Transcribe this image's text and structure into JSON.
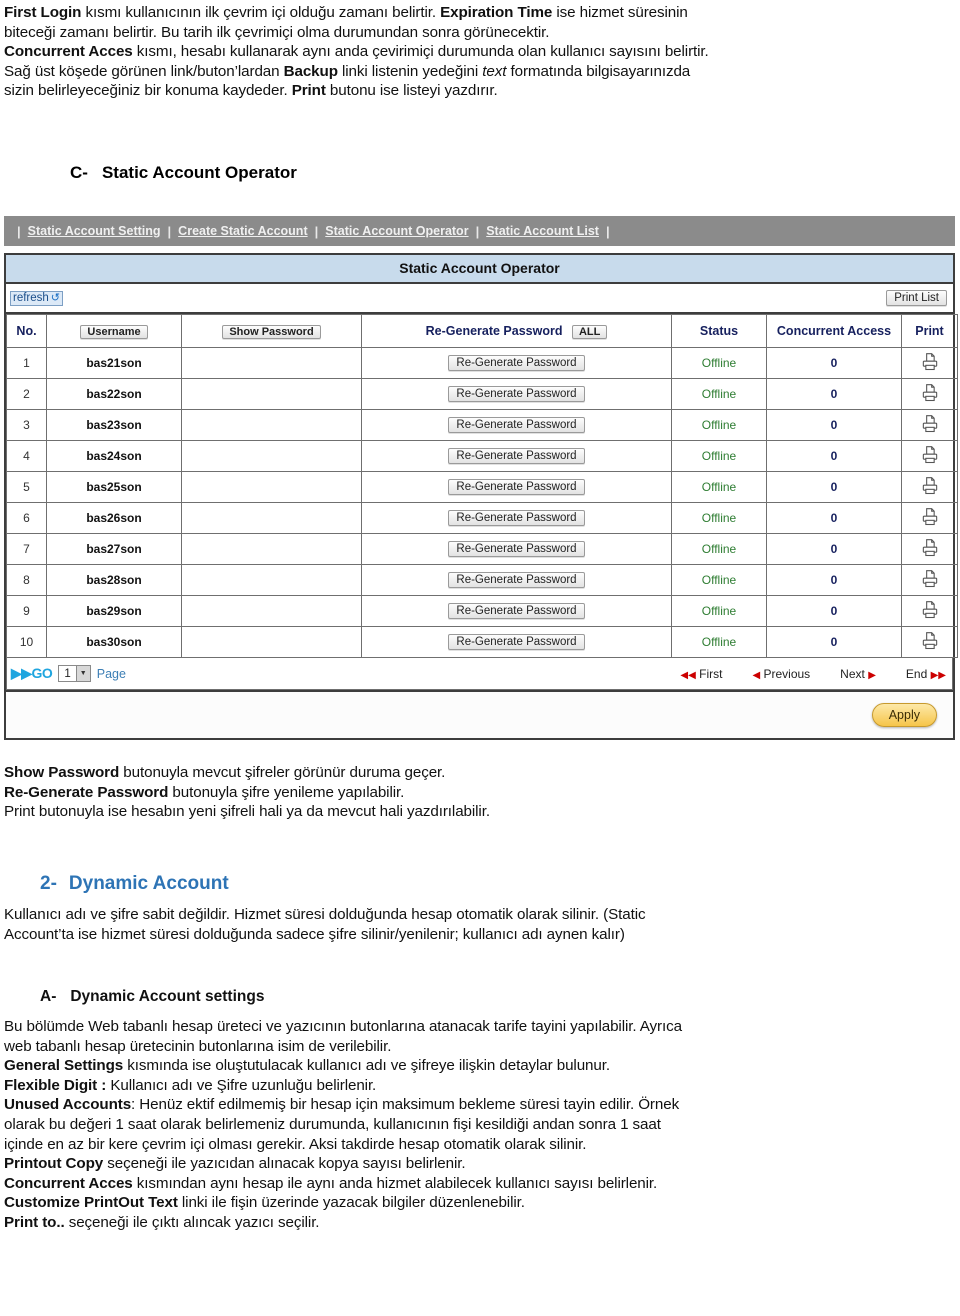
{
  "doc": {
    "intro": [
      {
        "id": "p1",
        "runs": [
          {
            "t": "First Login",
            "s": "b"
          },
          {
            "t": " kısmı kullanıcının ilk çevrim içi olduğu zamanı belirtir. ",
            "s": ""
          },
          {
            "t": "Expiration Time",
            "s": "b"
          },
          {
            "t": " ise hizmet süresinin",
            "s": ""
          }
        ]
      },
      {
        "id": "p2",
        "runs": [
          {
            "t": "biteceği zamanı belirtir. Bu tarih ilk çevrimiçi olma durumundan sonra görünecektir.",
            "s": ""
          }
        ]
      },
      {
        "id": "p3",
        "runs": [
          {
            "t": "Concurrent Acces",
            "s": "b"
          },
          {
            "t": " kısmı, hesabı kullanarak aynı anda çevirimiçi durumunda olan kullanıcı sayısını belirtir.",
            "s": ""
          }
        ]
      },
      {
        "id": "p4",
        "runs": [
          {
            "t": "Sağ üst köşede görünen link/buton’lardan ",
            "s": ""
          },
          {
            "t": "Backup",
            "s": "b"
          },
          {
            "t": " linki listenin yedeğini ",
            "s": ""
          },
          {
            "t": "text",
            "s": "i"
          },
          {
            "t": " formatında bilgisayarınızda",
            "s": ""
          }
        ]
      },
      {
        "id": "p5",
        "runs": [
          {
            "t": "sizin belirleyeceğiniz bir konuma kaydeder. ",
            "s": ""
          },
          {
            "t": "Print",
            "s": "b"
          },
          {
            "t": " butonu ise listeyi yazdırır.",
            "s": ""
          }
        ]
      }
    ],
    "heading_c": {
      "marker": "C-",
      "text": "Static Account Operator"
    },
    "after_shot": [
      {
        "id": "a1",
        "runs": [
          {
            "t": "Show Password",
            "s": "b"
          },
          {
            "t": " butonuyla mevcut şifreler görünür duruma geçer.",
            "s": ""
          }
        ]
      },
      {
        "id": "a2",
        "runs": [
          {
            "t": "Re-Generate Password",
            "s": "b"
          },
          {
            "t": " butonuyla şifre yenileme yapılabilir.",
            "s": ""
          }
        ]
      },
      {
        "id": "a3",
        "runs": [
          {
            "t": "Print butonuyla ise hesabın yeni şifreli hali ya da mevcut hali yazdırılabilir.",
            "s": ""
          }
        ]
      }
    ],
    "heading_dynamic": {
      "marker": "2-",
      "text": "Dynamic Account"
    },
    "dynamic_body": [
      {
        "id": "d1",
        "runs": [
          {
            "t": "Kullanıcı adı ve şifre  sabit değildir. Hizmet süresi dolduğunda hesap otomatik olarak silinir. (Static",
            "s": ""
          }
        ]
      },
      {
        "id": "d2",
        "runs": [
          {
            "t": "Account’ta ise hizmet süresi dolduğunda sadece şifre silinir/yenilenir; kullanıcı adı aynen kalır)",
            "s": ""
          }
        ]
      }
    ],
    "heading_a": {
      "marker": "A-",
      "text": "Dynamic Account settings"
    },
    "bottom_body": [
      {
        "id": "b1",
        "runs": [
          {
            "t": "Bu bölümde Web tabanlı hesap üreteci ve yazıcının butonlarına atanacak tarife tayini yapılabilir. Ayrıca",
            "s": ""
          }
        ]
      },
      {
        "id": "b2",
        "runs": [
          {
            "t": "web tabanlı hesap üretecinin butonlarına isim de verilebilir.",
            "s": ""
          }
        ]
      },
      {
        "id": "b3",
        "runs": [
          {
            "t": "General Settings",
            "s": "b"
          },
          {
            "t": " kısmında ise oluştutulacak kullanıcı adı ve şifreye ilişkin detaylar bulunur.",
            "s": ""
          }
        ]
      },
      {
        "id": "b4",
        "runs": [
          {
            "t": "Flexible Digit :",
            "s": "b"
          },
          {
            "t": " Kullanıcı adı ve Şifre uzunluğu belirlenir.",
            "s": ""
          }
        ]
      },
      {
        "id": "b5",
        "runs": [
          {
            "t": "Unused Accounts",
            "s": "b"
          },
          {
            "t": ": Henüz ektif edilmemiş bir hesap için maksimum bekleme süresi tayin edilir. Örnek",
            "s": ""
          }
        ]
      },
      {
        "id": "b6",
        "runs": [
          {
            "t": "olarak bu değeri 1 saat olarak belirlemeniz durumunda, kullanıcının fişi kesildiği andan sonra 1 saat",
            "s": ""
          }
        ]
      },
      {
        "id": "b7",
        "runs": [
          {
            "t": "içinde en az bir kere çevrim içi olması gerekir. Aksi takdirde hesap otomatik olarak silinir.",
            "s": ""
          }
        ]
      },
      {
        "id": "b8",
        "runs": [
          {
            "t": "Printout Copy",
            "s": "b"
          },
          {
            "t": " seçeneği ile yazıcıdan alınacak kopya sayısı belirlenir.",
            "s": ""
          }
        ]
      },
      {
        "id": "b9",
        "runs": [
          {
            "t": "Concurrent Acces",
            "s": "b"
          },
          {
            "t": " kısmından aynı hesap ile aynı anda hizmet alabilecek kullanıcı sayısı belirlenir.",
            "s": ""
          }
        ]
      },
      {
        "id": "b10",
        "runs": [
          {
            "t": "Customize PrintOut Text",
            "s": "b"
          },
          {
            "t": " linki ile fişin üzerinde yazacak bilgiler düzenlenebilir.",
            "s": ""
          }
        ]
      },
      {
        "id": "b11",
        "runs": [
          {
            "t": "Print to..",
            "s": "b"
          },
          {
            "t": " seçeneği ile çıktı alıncak yazıcı seçilir.",
            "s": ""
          }
        ]
      }
    ]
  },
  "app": {
    "menu": {
      "separator": "|",
      "items": [
        {
          "label": "Static Account Setting"
        },
        {
          "label": "Create Static Account"
        },
        {
          "label": "Static Account Operator"
        },
        {
          "label": "Static Account List"
        }
      ]
    },
    "panel_title": "Static Account Operator",
    "toolbar": {
      "refresh_label": "refresh",
      "refresh_icon": "refresh-arrows-icon",
      "print_list_label": "Print List"
    },
    "table": {
      "headers": {
        "no": "No.",
        "username_button": "Username",
        "show_password_button": "Show Password",
        "regenerate_label": "Re-Generate Password",
        "regenerate_all_button": "ALL",
        "status": "Status",
        "concurrent_access": "Concurrent Access",
        "print": "Print"
      },
      "row_button_label": "Re-Generate Password",
      "print_icon": "printer-icon",
      "rows": [
        {
          "no": "1",
          "username": "bas21son",
          "password": "",
          "status": "Offline",
          "concurrent": "0"
        },
        {
          "no": "2",
          "username": "bas22son",
          "password": "",
          "status": "Offline",
          "concurrent": "0"
        },
        {
          "no": "3",
          "username": "bas23son",
          "password": "",
          "status": "Offline",
          "concurrent": "0"
        },
        {
          "no": "4",
          "username": "bas24son",
          "password": "",
          "status": "Offline",
          "concurrent": "0"
        },
        {
          "no": "5",
          "username": "bas25son",
          "password": "",
          "status": "Offline",
          "concurrent": "0"
        },
        {
          "no": "6",
          "username": "bas26son",
          "password": "",
          "status": "Offline",
          "concurrent": "0"
        },
        {
          "no": "7",
          "username": "bas27son",
          "password": "",
          "status": "Offline",
          "concurrent": "0"
        },
        {
          "no": "8",
          "username": "bas28son",
          "password": "",
          "status": "Offline",
          "concurrent": "0"
        },
        {
          "no": "9",
          "username": "bas29son",
          "password": "",
          "status": "Offline",
          "concurrent": "0"
        },
        {
          "no": "10",
          "username": "bas30son",
          "password": "",
          "status": "Offline",
          "concurrent": "0"
        }
      ]
    },
    "pager": {
      "go_label": "GO",
      "go_icon": "double-chevron-right-icon",
      "page_value": "1",
      "page_label": "Page",
      "first": "First",
      "previous": "Previous",
      "next": "Next",
      "end": "End"
    },
    "apply_label": "Apply",
    "colors": {
      "menubar_bg": "#8b8b8b",
      "panel_title_bg": "#c8dbec",
      "header_text": "#16205e",
      "status_offline": "#2e7d32",
      "pager_link": "#3d7fb5",
      "go_accent": "#1fa5df",
      "nav_arrow": "#cc0000",
      "apply_bg": "#f6c54a"
    }
  }
}
